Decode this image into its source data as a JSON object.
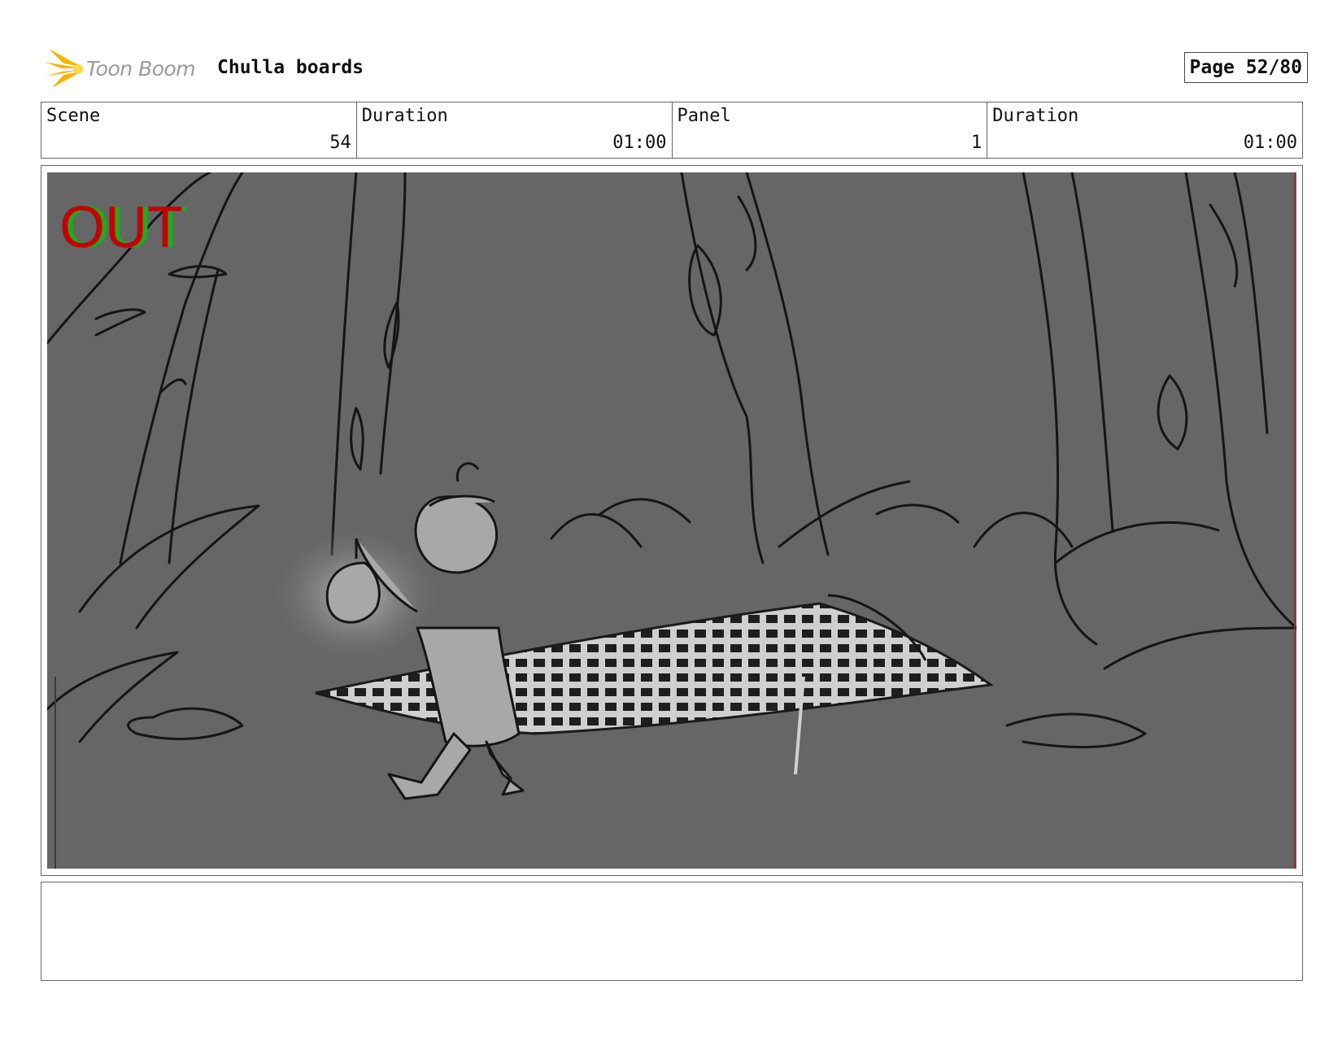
{
  "header": {
    "brand": "Toon Boom",
    "project_title": "Chulla boards",
    "page_label": "Page 52/80"
  },
  "info": [
    {
      "label": "Scene",
      "value": "54"
    },
    {
      "label": "Duration",
      "value": "01:00"
    },
    {
      "label": "Panel",
      "value": "1"
    },
    {
      "label": "Duration",
      "value": "01:00"
    }
  ],
  "panel": {
    "overlay_text": "OUT",
    "overlay_colors": {
      "primary": "#c40000",
      "secondary": "#1faa1f"
    },
    "background_color": "#666666"
  },
  "notes": {
    "text": ""
  }
}
